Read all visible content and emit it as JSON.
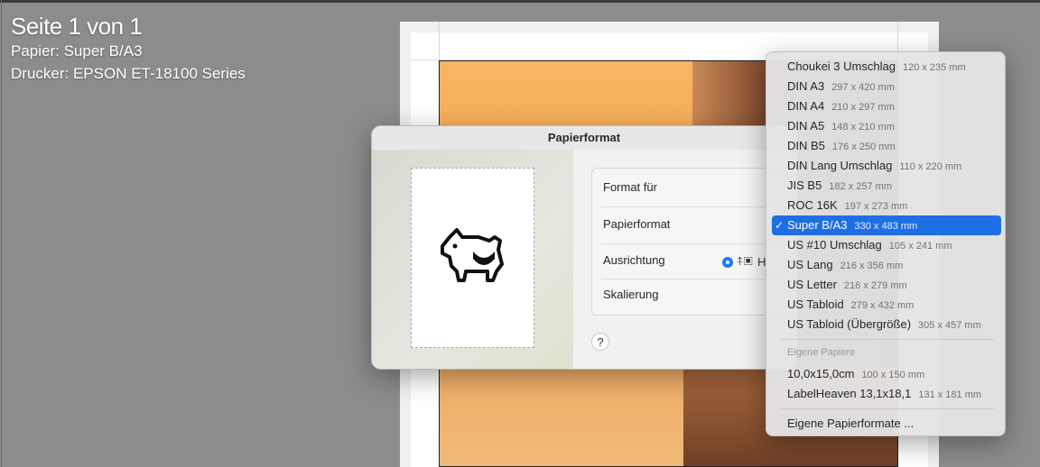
{
  "info": {
    "page_label": "Seite 1 von 1",
    "paper_line": "Papier:  Super B/A3",
    "printer_line": "Drucker:  EPSON ET-18100 Series"
  },
  "dialog": {
    "title": "Papierformat",
    "rows": {
      "format_for": "Format für",
      "paper_format": "Papierformat",
      "orientation": "Ausrichtung",
      "scaling": "Skalierung"
    },
    "orientation_partial_label": "H",
    "help_label": "?"
  },
  "menu": {
    "items": [
      {
        "name": "Choukei 3 Umschlag",
        "dim": "120 x 235 mm"
      },
      {
        "name": "DIN A3",
        "dim": "297 x 420 mm"
      },
      {
        "name": "DIN A4",
        "dim": "210 x 297 mm"
      },
      {
        "name": "DIN A5",
        "dim": "148 x 210 mm"
      },
      {
        "name": "DIN B5",
        "dim": "176 x 250 mm"
      },
      {
        "name": "DIN Lang Umschlag",
        "dim": "110 x 220 mm"
      },
      {
        "name": "JIS B5",
        "dim": "182 x 257 mm"
      },
      {
        "name": "ROC 16K",
        "dim": "197 x 273 mm"
      },
      {
        "name": "Super B/A3",
        "dim": "330 x 483 mm"
      },
      {
        "name": "US #10 Umschlag",
        "dim": "105 x 241 mm"
      },
      {
        "name": "US Lang",
        "dim": "216 x 356 mm"
      },
      {
        "name": "US Letter",
        "dim": "216 x 279 mm"
      },
      {
        "name": "US Tabloid",
        "dim": "279 x 432 mm"
      },
      {
        "name": "US Tabloid (Übergröße)",
        "dim": "305 x 457 mm"
      }
    ],
    "selected_index": 8,
    "check_mark": "✓",
    "custom_header": "Eigene Papiere",
    "custom_items": [
      {
        "name": "10,0x15,0cm",
        "dim": "100 x 150 mm"
      },
      {
        "name": "LabelHeaven 13,1x18,1",
        "dim": "131 x 181 mm"
      }
    ],
    "manage_label": "Eigene Papierformate ..."
  },
  "colors": {
    "selection": "#1e6fe5",
    "background": "#8c8c8c"
  }
}
